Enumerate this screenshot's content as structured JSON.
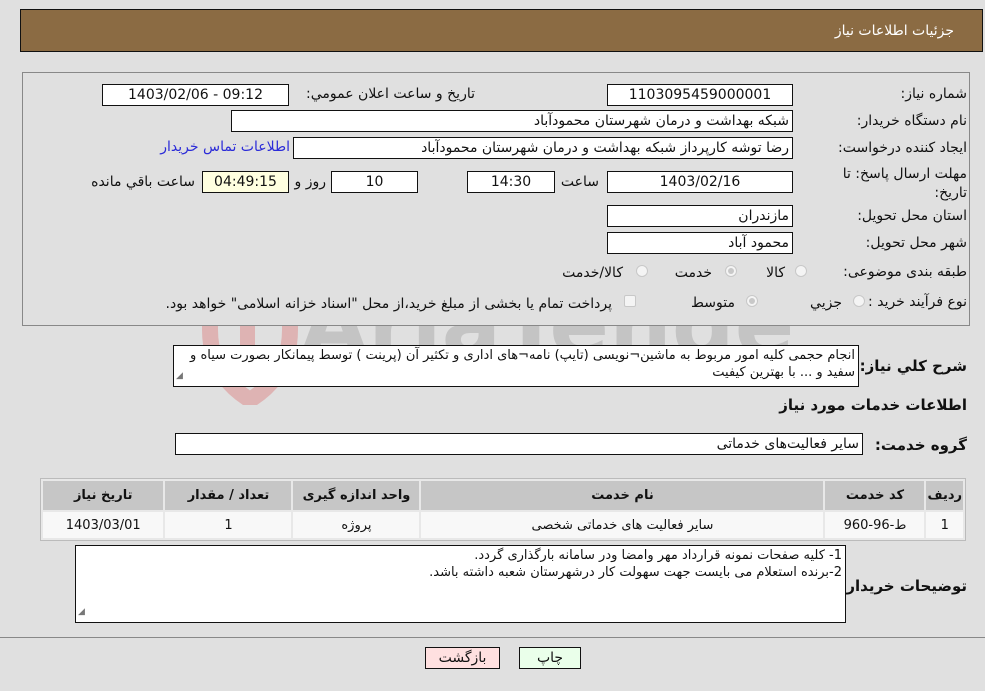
{
  "header": {
    "title": "جزئيات اطلاعات نياز"
  },
  "form": {
    "need_number": {
      "label": "شماره نياز:",
      "value": "1103095459000001"
    },
    "announce": {
      "label": "تاريخ و ساعت اعلان عمومي:",
      "value": "1403/02/06 - 09:12"
    },
    "buyer_org": {
      "label": "نام دستگاه خريدار:",
      "value": "شبکه بهداشت و درمان شهرستان محمودآباد"
    },
    "creator": {
      "label": "ايجاد کننده درخواست:",
      "value": "رضا توشه کارپرداز شبکه بهداشت و درمان شهرستان محمودآباد"
    },
    "contact_link": "اطلاعات تماس خريدار",
    "deadline": {
      "label": "مهلت ارسال پاسخ: تا تاريخ:",
      "date": "1403/02/16",
      "time_label": "ساعت",
      "time": "14:30",
      "days": "10",
      "days_label": "روز و",
      "remaining": "04:49:15",
      "remaining_label": "ساعت باقي مانده"
    },
    "province": {
      "label": "استان محل تحويل:",
      "value": "مازندران"
    },
    "city": {
      "label": "شهر محل تحويل:",
      "value": "محمود آباد"
    },
    "category": {
      "label": "طبقه بندی موضوعی:",
      "options": [
        "کالا",
        "خدمت",
        "کالا/خدمت"
      ],
      "selected": "خدمت"
    },
    "purchase_type": {
      "label": "نوع فرآيند خريد :",
      "options": [
        "جزيي",
        "متوسط"
      ],
      "selected": "متوسط",
      "payment_note": "پرداخت تمام يا بخشی از مبلغ خريد،از محل \"اسناد خزانه اسلامی\" خواهد بود.",
      "payment_checked": false
    }
  },
  "description": {
    "label": "شرح کلي نياز:",
    "text": "انجام حجمی کلیه امور مربوط به ماشین¬نویسی (تایپ) نامه¬های اداری و تکثیر آن (پرینت ) توسط پیمانکار بصورت سیاه و سفید و ...  با بهترین کیفیت"
  },
  "services_section": {
    "title": "اطلاعات خدمات مورد نياز",
    "group_label": "گروه خدمت:",
    "group_value": "ساير فعاليت‌هاى خدماتى"
  },
  "table": {
    "headers": [
      "رديف",
      "کد خدمت",
      "نام خدمت",
      "واحد اندازه گيری",
      "تعداد / مقدار",
      "تاريخ نياز"
    ],
    "rows": [
      [
        "1",
        "ط-96-960",
        "ساير فعاليت های خدماتی شخصی",
        "پروژه",
        "1",
        "1403/03/01"
      ]
    ]
  },
  "buyer_notes": {
    "label": "توضيحات خريدار:",
    "lines": [
      "1- کلیه صفحات نمونه قرارداد مهر وامضا ودر سامانه بارگذاری گردد.",
      "2-برنده استعلام می بایست جهت سهولت کار درشهرستان شعبه داشته باشد."
    ]
  },
  "buttons": {
    "print": "چاپ",
    "back": "بازگشت"
  },
  "watermark": {
    "text": "AriaTender.neT"
  },
  "colors": {
    "header_bg": "#8b6b43",
    "print_bg": "#eaffea",
    "back_bg": "#ffe0e0",
    "link": "#2b2bd8"
  }
}
